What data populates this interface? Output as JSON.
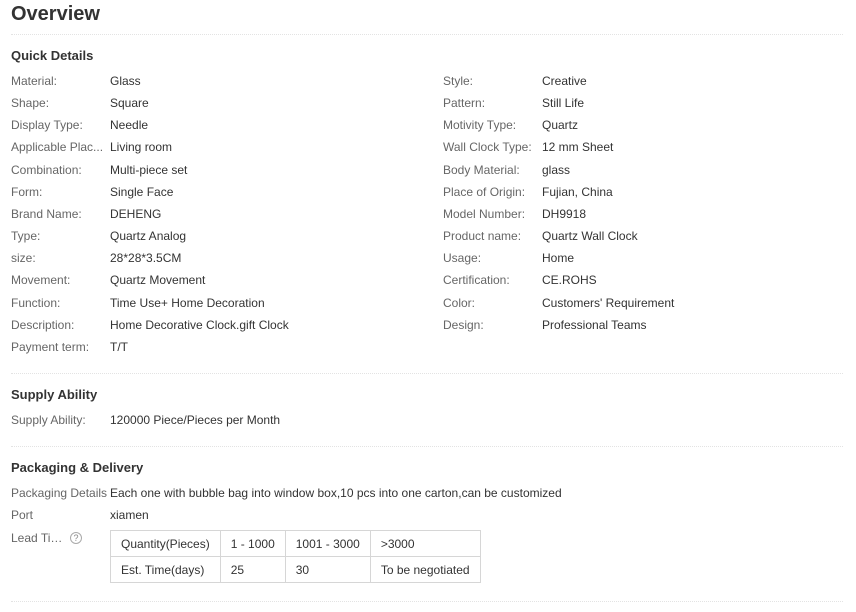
{
  "page": {
    "title": "Overview"
  },
  "quick_details": {
    "title": "Quick Details",
    "left": [
      {
        "label": "Material:",
        "value": "Glass"
      },
      {
        "label": "Shape:",
        "value": "Square"
      },
      {
        "label": "Display Type:",
        "value": "Needle"
      },
      {
        "label": "Applicable Plac...",
        "value": "Living room"
      },
      {
        "label": "Combination:",
        "value": "Multi-piece set"
      },
      {
        "label": "Form:",
        "value": "Single Face"
      },
      {
        "label": "Brand Name:",
        "value": "DEHENG"
      },
      {
        "label": "Type:",
        "value": "Quartz Analog"
      },
      {
        "label": "size:",
        "value": "28*28*3.5CM"
      },
      {
        "label": "Movement:",
        "value": "Quartz Movement"
      },
      {
        "label": "Function:",
        "value": "Time Use+ Home Decoration"
      },
      {
        "label": "Description:",
        "value": "Home Decorative Clock.gift Clock"
      },
      {
        "label": "Payment term:",
        "value": "T/T"
      }
    ],
    "right": [
      {
        "label": "Style:",
        "value": "Creative"
      },
      {
        "label": "Pattern:",
        "value": "Still Life"
      },
      {
        "label": "Motivity Type:",
        "value": "Quartz"
      },
      {
        "label": "Wall Clock Type:",
        "value": "12 mm Sheet"
      },
      {
        "label": "Body Material:",
        "value": "glass"
      },
      {
        "label": "Place of Origin:",
        "value": "Fujian, China"
      },
      {
        "label": "Model Number:",
        "value": "DH9918"
      },
      {
        "label": "Product name:",
        "value": "Quartz Wall Clock"
      },
      {
        "label": "Usage:",
        "value": "Home"
      },
      {
        "label": "Certification:",
        "value": "CE.ROHS"
      },
      {
        "label": "Color:",
        "value": "Customers' Requirement"
      },
      {
        "label": "Design:",
        "value": "Professional Teams"
      }
    ]
  },
  "supply_ability": {
    "title": "Supply Ability",
    "label": "Supply Ability:",
    "value": "120000 Piece/Pieces per Month"
  },
  "packaging": {
    "title": "Packaging & Delivery",
    "details_label": "Packaging Details",
    "details_value": "Each one with bubble bag into window box,10 pcs into one carton,can be customized",
    "port_label": "Port",
    "port_value": "xiamen",
    "lead_label": "Lead Time",
    "lead_icon": "help-circle-icon",
    "lead_table": {
      "rows": [
        [
          "Quantity(Pieces)",
          "1 - 1000",
          "1001 - 3000",
          ">3000"
        ],
        [
          "Est. Time(days)",
          "25",
          "30",
          "To be negotiated"
        ]
      ]
    }
  }
}
